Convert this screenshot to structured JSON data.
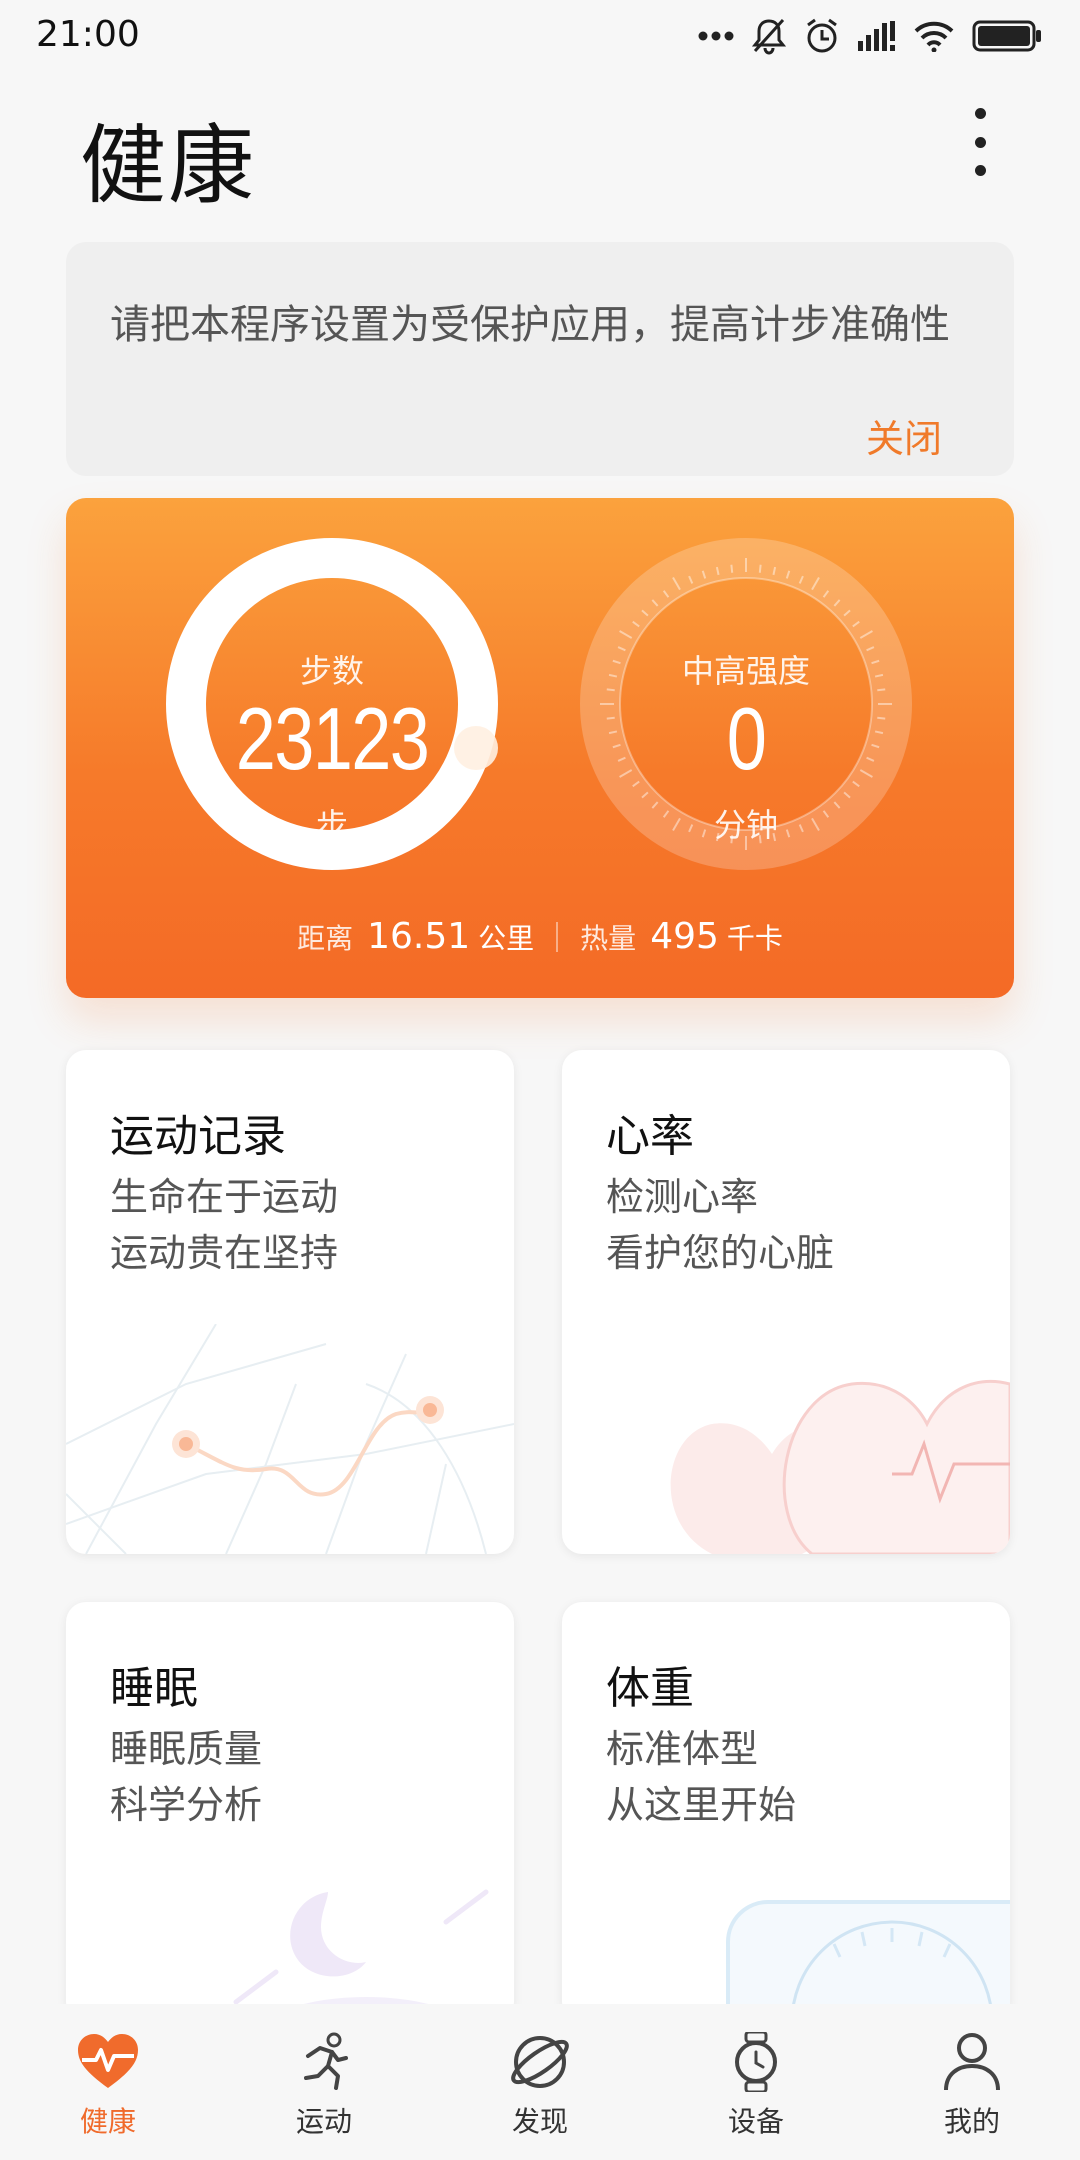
{
  "status_bar": {
    "time": "21:00"
  },
  "header": {
    "title": "健康"
  },
  "notice": {
    "text": "请把本程序设置为受保护应用，提高计步准确性",
    "close_label": "关闭"
  },
  "summary": {
    "steps": {
      "label": "步数",
      "value": "23123",
      "unit": "步"
    },
    "intensity": {
      "label": "中高强度",
      "value": "0",
      "unit": "分钟"
    },
    "distance": {
      "label": "距离",
      "value": "16.51",
      "unit": "公里"
    },
    "calories": {
      "label": "热量",
      "value": "495",
      "unit": "千卡"
    },
    "colors": {
      "accent": "#f67a2a",
      "accent_light": "#fba23d"
    }
  },
  "cards": [
    {
      "title": "运动记录",
      "line1": "生命在于运动",
      "line2": "运动贵在坚持",
      "icon": "route-map-illustration"
    },
    {
      "title": "心率",
      "line1": "检测心率",
      "line2": "看护您的心脏",
      "icon": "heart-illustration"
    },
    {
      "title": "睡眠",
      "line1": "睡眠质量",
      "line2": "科学分析",
      "icon": "moon-illustration"
    },
    {
      "title": "体重",
      "line1": "标准体型",
      "line2": "从这里开始",
      "icon": "scale-illustration"
    }
  ],
  "nav": [
    {
      "label": "健康",
      "icon": "heart-pulse-icon",
      "active": true
    },
    {
      "label": "运动",
      "icon": "runner-icon",
      "active": false
    },
    {
      "label": "发现",
      "icon": "planet-icon",
      "active": false
    },
    {
      "label": "设备",
      "icon": "watch-icon",
      "active": false
    },
    {
      "label": "我的",
      "icon": "person-icon",
      "active": false
    }
  ]
}
